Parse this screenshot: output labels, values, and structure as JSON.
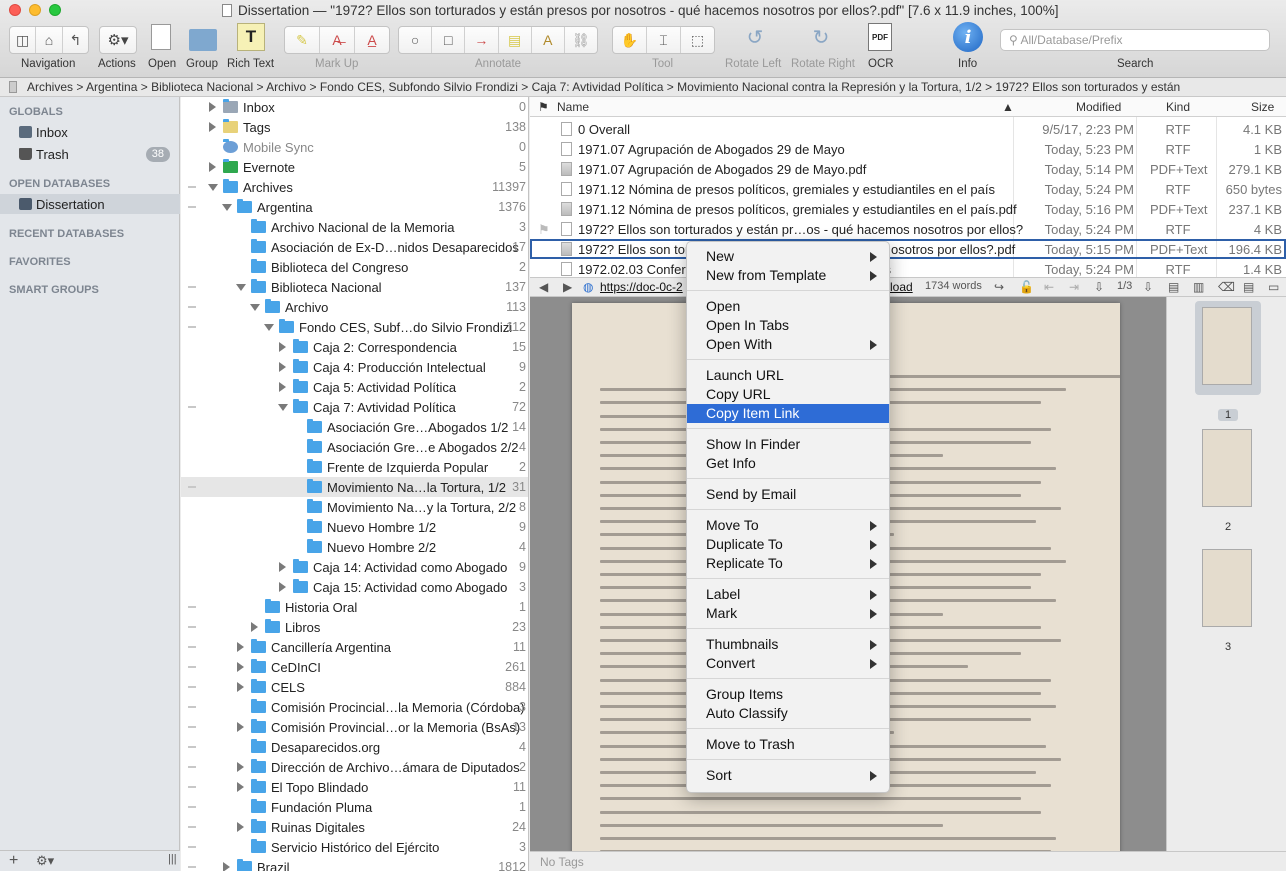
{
  "window": {
    "title": "Dissertation — \"1972? Ellos son torturados y están presos por nosotros - qué hacemos nosotros por ellos?.pdf\" [7.6 x 11.9 inches, 100%]"
  },
  "toolbar": {
    "navigation": "Navigation",
    "actions": "Actions",
    "open": "Open",
    "group": "Group",
    "rich_text": "Rich Text",
    "mark_up": "Mark Up",
    "annotate": "Annotate",
    "tool": "Tool",
    "rotate_left": "Rotate Left",
    "rotate_right": "Rotate Right",
    "ocr": "OCR",
    "info": "Info",
    "search": "Search",
    "search_placeholder": "All/Database/Prefix"
  },
  "pathbar": {
    "path": "Archives > Argentina > Biblioteca Nacional > Archivo > Fondo CES, Subfondo Silvio Frondizi > Caja 7: Avtividad Política > Movimiento Nacional contra la Represión y la Tortura, 1/2 > 1972? Ellos son torturados y están"
  },
  "sidebar": {
    "globals": "GLOBALS",
    "inbox": "Inbox",
    "trash": "Trash",
    "trash_count": "38",
    "open_databases": "OPEN DATABASES",
    "dissertation": "Dissertation",
    "recent_databases": "RECENT DATABASES",
    "favorites": "FAVORITES",
    "smart_groups": "SMART GROUPS"
  },
  "tree": [
    {
      "label": "Inbox",
      "count": "0",
      "indent": 0,
      "arrow": "right"
    },
    {
      "label": "Tags",
      "count": "138",
      "indent": 0,
      "arrow": "right"
    },
    {
      "label": "Mobile Sync",
      "count": "0",
      "indent": 0,
      "arrow": "none"
    },
    {
      "label": "Evernote",
      "count": "5",
      "indent": 0,
      "arrow": "right"
    },
    {
      "label": "Archives",
      "count": "11397",
      "indent": 0,
      "arrow": "down"
    },
    {
      "label": "Argentina",
      "count": "1376",
      "indent": 1,
      "arrow": "down"
    },
    {
      "label": "Archivo Nacional de la Memoria",
      "count": "3",
      "indent": 2,
      "arrow": "none"
    },
    {
      "label": "Asociación de Ex-D…nidos Desaparecidos",
      "count": "17",
      "indent": 2,
      "arrow": "none"
    },
    {
      "label": "Biblioteca del Congreso",
      "count": "2",
      "indent": 2,
      "arrow": "none"
    },
    {
      "label": "Biblioteca Nacional",
      "count": "137",
      "indent": 2,
      "arrow": "down"
    },
    {
      "label": "Archivo",
      "count": "113",
      "indent": 3,
      "arrow": "down"
    },
    {
      "label": "Fondo CES, Subf…do Silvio Frondizi",
      "count": "112",
      "indent": 4,
      "arrow": "down"
    },
    {
      "label": "Caja 2: Correspondencia",
      "count": "15",
      "indent": 5,
      "arrow": "right"
    },
    {
      "label": "Caja 4: Producción Intelectual",
      "count": "9",
      "indent": 5,
      "arrow": "right"
    },
    {
      "label": "Caja 5: Actividad Política",
      "count": "2",
      "indent": 5,
      "arrow": "right"
    },
    {
      "label": "Caja 7: Avtividad Política",
      "count": "72",
      "indent": 5,
      "arrow": "down"
    },
    {
      "label": "Asociación Gre…Abogados 1/2",
      "count": "14",
      "indent": 6,
      "arrow": "none"
    },
    {
      "label": "Asociación Gre…e Abogados 2/2",
      "count": "4",
      "indent": 6,
      "arrow": "none"
    },
    {
      "label": "Frente de Izquierda Popular",
      "count": "2",
      "indent": 6,
      "arrow": "none"
    },
    {
      "label": "Movimiento Na…la Tortura, 1/2",
      "count": "31",
      "indent": 6,
      "arrow": "none",
      "highlight": true
    },
    {
      "label": "Movimiento Na…y la Tortura, 2/2",
      "count": "8",
      "indent": 6,
      "arrow": "none"
    },
    {
      "label": "Nuevo Hombre 1/2",
      "count": "9",
      "indent": 6,
      "arrow": "none"
    },
    {
      "label": "Nuevo Hombre 2/2",
      "count": "4",
      "indent": 6,
      "arrow": "none"
    },
    {
      "label": "Caja 14: Actividad como Abogado",
      "count": "9",
      "indent": 5,
      "arrow": "right"
    },
    {
      "label": "Caja 15: Actividad como Abogado",
      "count": "3",
      "indent": 5,
      "arrow": "right"
    },
    {
      "label": "Historia Oral",
      "count": "1",
      "indent": 3,
      "arrow": "none"
    },
    {
      "label": "Libros",
      "count": "23",
      "indent": 3,
      "arrow": "right"
    },
    {
      "label": "Cancillería Argentina",
      "count": "11",
      "indent": 2,
      "arrow": "right"
    },
    {
      "label": "CeDInCI",
      "count": "261",
      "indent": 2,
      "arrow": "right"
    },
    {
      "label": "CELS",
      "count": "884",
      "indent": 2,
      "arrow": "right"
    },
    {
      "label": "Comisión Procincial…la Memoria (Córdoba)",
      "count": "3",
      "indent": 2,
      "arrow": "none"
    },
    {
      "label": "Comisión Provincial…or la Memoria (BsAs)",
      "count": "13",
      "indent": 2,
      "arrow": "right"
    },
    {
      "label": "Desaparecidos.org",
      "count": "4",
      "indent": 2,
      "arrow": "none"
    },
    {
      "label": "Dirección de Archivo…ámara de Diputados",
      "count": "2",
      "indent": 2,
      "arrow": "right"
    },
    {
      "label": "El Topo Blindado",
      "count": "11",
      "indent": 2,
      "arrow": "right"
    },
    {
      "label": "Fundación Pluma",
      "count": "1",
      "indent": 2,
      "arrow": "none"
    },
    {
      "label": "Ruinas Digitales",
      "count": "24",
      "indent": 2,
      "arrow": "right"
    },
    {
      "label": "Servicio Histórico del Ejército",
      "count": "3",
      "indent": 2,
      "arrow": "none"
    },
    {
      "label": "Brazil",
      "count": "1812",
      "indent": 1,
      "arrow": "right"
    }
  ],
  "list": {
    "headers": {
      "name": "Name",
      "modified": "Modified",
      "kind": "Kind",
      "size": "Size"
    },
    "rows": [
      {
        "name": "0 Overall",
        "modified": "9/5/17, 2:23 PM",
        "kind": "RTF",
        "size": "4.1 KB",
        "pdf": false
      },
      {
        "name": "1971.07 Agrupación de Abogados 29 de Mayo",
        "modified": "Today, 5:23 PM",
        "kind": "RTF",
        "size": "1 KB",
        "pdf": false
      },
      {
        "name": "1971.07 Agrupación de Abogados 29 de Mayo.pdf",
        "modified": "Today, 5:14 PM",
        "kind": "PDF+Text",
        "size": "279.1 KB",
        "pdf": true
      },
      {
        "name": "1971.12 Nómina de presos políticos, gremiales y estudiantiles en el país",
        "modified": "Today, 5:24 PM",
        "kind": "RTF",
        "size": "650 bytes",
        "pdf": false
      },
      {
        "name": "1971.12 Nómina de presos políticos, gremiales y estudiantiles en el país.pdf",
        "modified": "Today, 5:16 PM",
        "kind": "PDF+Text",
        "size": "237.1 KB",
        "pdf": true
      },
      {
        "name": "1972? Ellos son torturados y están pr…os - qué hacemos nosotros por ellos?",
        "modified": "Today, 5:24 PM",
        "kind": "RTF",
        "size": "4 KB",
        "pdf": false
      },
      {
        "name": "1972? Ellos son tor",
        "name_tail": "osotros por ellos?.pdf",
        "modified": "Today, 5:15 PM",
        "kind": "PDF+Text",
        "size": "196.4 KB",
        "pdf": true,
        "selected": true
      },
      {
        "name": "1972.02.03 Confere",
        "name_tail": "dos",
        "modified": "Today, 5:24 PM",
        "kind": "RTF",
        "size": "1.4 KB",
        "pdf": false
      }
    ]
  },
  "doctoolbar": {
    "url": "https://doc-0c-2",
    "url_tail": "load",
    "words": "1734 words",
    "page": "1/3"
  },
  "thumbs": [
    "1",
    "2",
    "3"
  ],
  "tags_bar": "No Tags",
  "context_menu": {
    "groups": [
      [
        {
          "label": "New",
          "sub": true
        },
        {
          "label": "New from Template",
          "sub": true
        }
      ],
      [
        {
          "label": "Open",
          "sub": false
        },
        {
          "label": "Open In Tabs",
          "sub": false
        },
        {
          "label": "Open With",
          "sub": true
        }
      ],
      [
        {
          "label": "Launch URL",
          "sub": false
        },
        {
          "label": "Copy URL",
          "sub": false
        },
        {
          "label": "Copy Item Link",
          "sub": false,
          "active": true
        }
      ],
      [
        {
          "label": "Show In Finder",
          "sub": false
        },
        {
          "label": "Get Info",
          "sub": false
        }
      ],
      [
        {
          "label": "Send by Email",
          "sub": false
        }
      ],
      [
        {
          "label": "Move To",
          "sub": true
        },
        {
          "label": "Duplicate To",
          "sub": true
        },
        {
          "label": "Replicate To",
          "sub": true
        }
      ],
      [
        {
          "label": "Label",
          "sub": true
        },
        {
          "label": "Mark",
          "sub": true
        }
      ],
      [
        {
          "label": "Thumbnails",
          "sub": true
        },
        {
          "label": "Convert",
          "sub": true
        }
      ],
      [
        {
          "label": "Group Items",
          "sub": false
        },
        {
          "label": "Auto Classify",
          "sub": false
        }
      ],
      [
        {
          "label": "Move to Trash",
          "sub": false
        }
      ],
      [
        {
          "label": "Sort",
          "sub": true
        }
      ]
    ]
  },
  "colors": {
    "accent": "#2e6cd6",
    "folder": "#48a4e8",
    "selection_outline": "#2e5fa8"
  }
}
